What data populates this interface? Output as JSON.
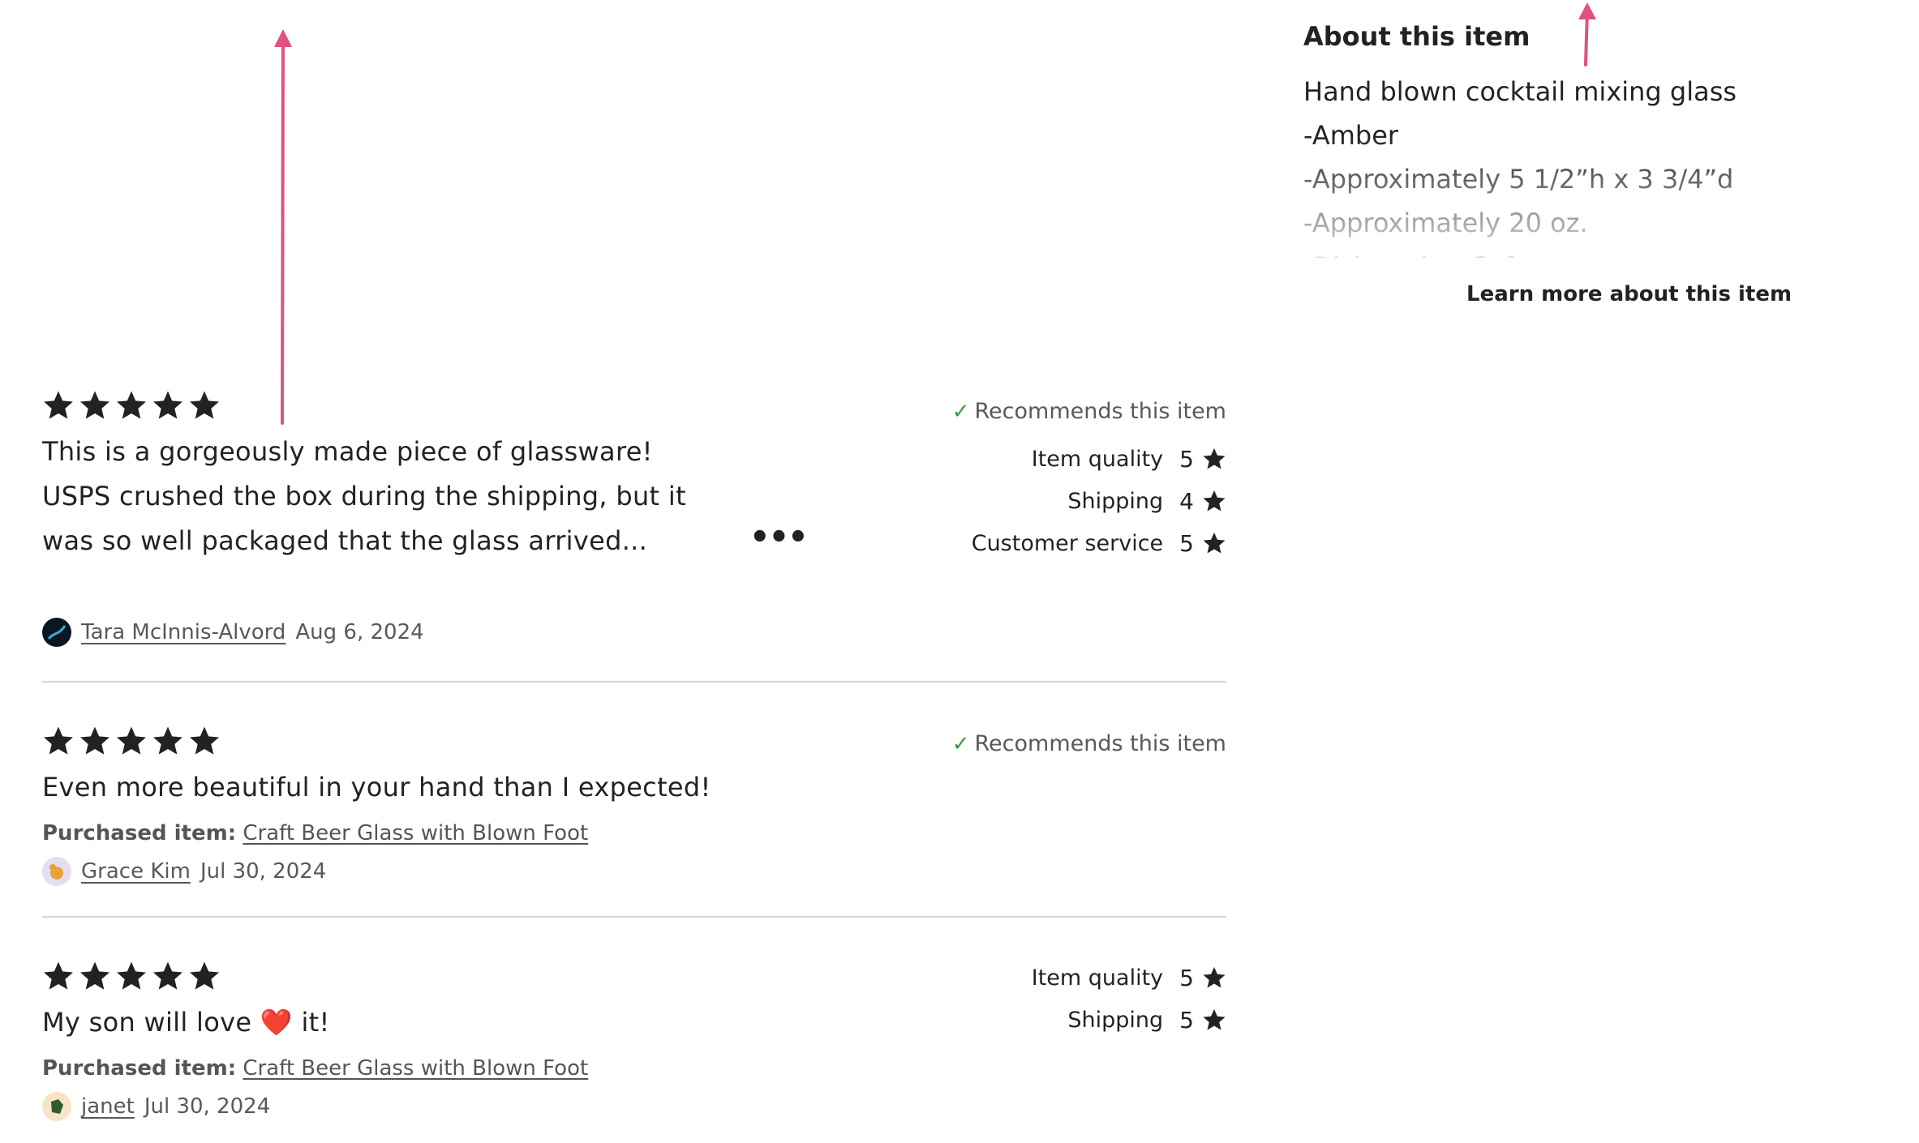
{
  "about": {
    "title": "About this item",
    "lines": [
      "Hand blown cocktail mixing glass",
      "-Amber",
      "-Approximately 5 1/2”h x 3 3/4”d",
      "-Approximately 20 oz.",
      "-Dishwasher Safe"
    ],
    "learn_more": "Learn more about this item"
  },
  "reviews": [
    {
      "stars": 5,
      "text": "This is a gorgeously made piece of glassware! USPS crushed the box during the shipping, but it was so well packaged that the glass arrived...",
      "more": "•••",
      "recommends": "Recommends this item",
      "ratings": [
        {
          "label": "Item quality",
          "value": "5"
        },
        {
          "label": "Shipping",
          "value": "4"
        },
        {
          "label": "Customer service",
          "value": "5"
        }
      ],
      "author": "Tara McInnis-Alvord",
      "date": "Aug 6, 2024"
    },
    {
      "stars": 5,
      "text": "Even more beautiful in your hand than I expected!",
      "recommends": "Recommends this item",
      "purchased_label": "Purchased item:",
      "purchased_item": "Craft Beer Glass with Blown Foot",
      "author": "Grace Kim",
      "date": "Jul 30, 2024"
    },
    {
      "stars": 5,
      "text_before": "My son will love",
      "emoji": "❤️",
      "text_after": "it!",
      "ratings": [
        {
          "label": "Item quality",
          "value": "5"
        },
        {
          "label": "Shipping",
          "value": "5"
        }
      ],
      "purchased_label": "Purchased item:",
      "purchased_item": "Craft Beer Glass with Blown Foot",
      "author": "janet",
      "date": "Jul 30, 2024"
    }
  ],
  "colors": {
    "annotation_arrow": "#e0527f",
    "star": "#222222",
    "check": "#3a9a4a",
    "divider": "#d6d6d6"
  }
}
